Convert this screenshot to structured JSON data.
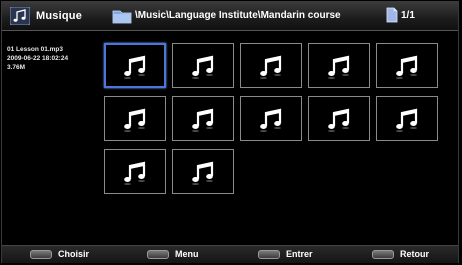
{
  "header": {
    "app_title": "Musique",
    "path": "\\Music\\Language Institute\\Mandarin course",
    "page": "1/1"
  },
  "file_info": {
    "name": "01 Lesson 01.mp3",
    "date": "2009-06-22 18:02:24",
    "size": "3.76M"
  },
  "grid": {
    "item_icon": "music-note-icon",
    "item_count": 12,
    "selected_index": 0
  },
  "footer": {
    "choose": "Choisir",
    "menu": "Menu",
    "enter": "Entrer",
    "back": "Retour"
  },
  "colors": {
    "selection": "#4a78d8",
    "tile_border": "#8a8a8a",
    "background": "#000000"
  }
}
